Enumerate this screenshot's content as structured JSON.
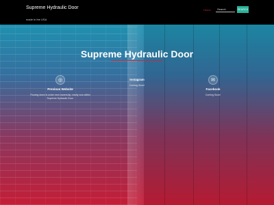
{
  "site": {
    "title": "Supreme Hydraulic Door",
    "tagline": "made in the USA"
  },
  "nav": {
    "home_label": "Home"
  },
  "search": {
    "placeholder": "Search",
    "button_label": "Search"
  },
  "hero": {
    "title": "Supreme Hydraulic Door"
  },
  "features": [
    {
      "icon": "globe-icon",
      "title": "Previous Website",
      "text": "Flowing down is under new ownership, easily now within Supreme Hydraulic Door."
    },
    {
      "icon": "instagram-icon",
      "title": "Instagram",
      "text": "Coming Soon!"
    },
    {
      "icon": "mail-icon",
      "title": "Facebook",
      "text": "Coming Soon!"
    }
  ],
  "colors": {
    "accent": "#c8203a",
    "button": "#2bb39b"
  }
}
